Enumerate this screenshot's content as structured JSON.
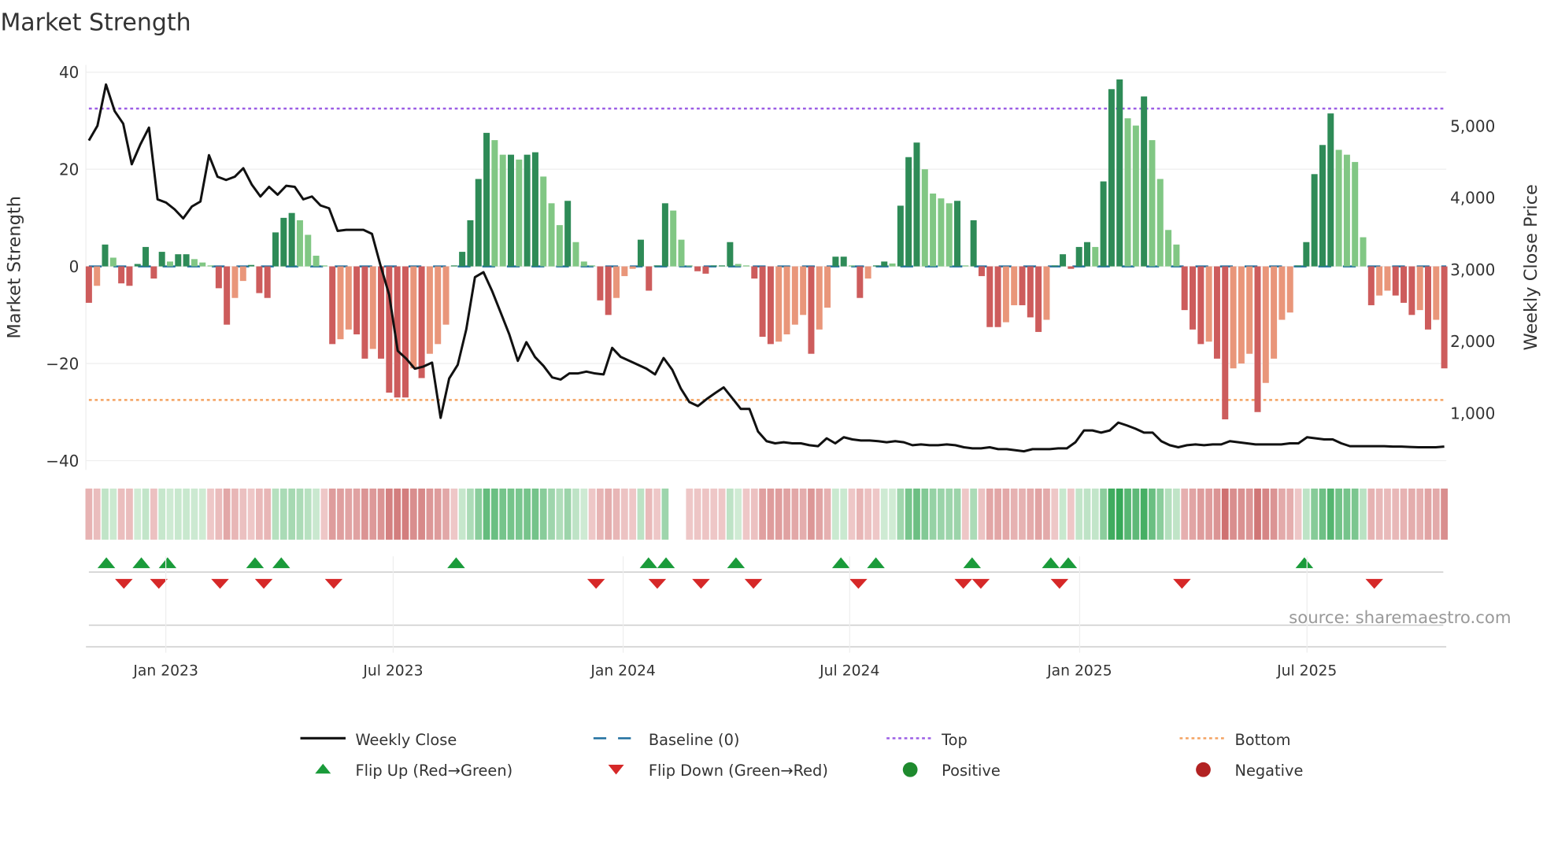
{
  "title": "Market Strength",
  "source": "source: sharemaestro.com",
  "colors": {
    "up_strong": "#2e8b57",
    "up_weak": "#81c784",
    "down_strong": "#cd5c5c",
    "down_weak": "#e9967a",
    "baseline": "#1f6f9f",
    "top": "#9b5de5",
    "bottom": "#f4a261",
    "flip_up": "#1a9b3a",
    "flip_down": "#d62828",
    "line": "#111111",
    "positive": "#1e8a2e",
    "negative": "#b22222"
  },
  "chart_data": {
    "type": "bar",
    "title": "Market Strength",
    "ylabel": "Market Strength",
    "y2label": "Weekly Close Price",
    "ylim": [
      -42,
      42
    ],
    "y2lim": [
      330,
      5740
    ],
    "yticks": [
      "40",
      "20",
      "0",
      "−20",
      "−40"
    ],
    "ytick_values": [
      40,
      20,
      0,
      -20,
      -40
    ],
    "y2ticks": [
      "5,000",
      "4,000",
      "3,000",
      "2,000",
      "1,000"
    ],
    "y2tick_values": [
      5000,
      4000,
      3000,
      2000,
      1000
    ],
    "xticks": [
      "Jan 2023",
      "Jul 2023",
      "Jan 2024",
      "Jul 2024",
      "Jan 2025",
      "Jul 2025"
    ],
    "xtick_weeks": [
      8.8,
      34.8,
      61.1,
      87.0,
      113.3,
      139.3
    ],
    "weeks": 156,
    "top_level": 32.5,
    "bottom_level": -27.5,
    "baseline": 0,
    "strength": [
      -7.5,
      -4,
      4.5,
      1.8,
      -3.5,
      -4,
      0.5,
      4,
      -2.5,
      3,
      1,
      2.5,
      2.5,
      1.5,
      0.8,
      0.2,
      -4.5,
      -12,
      -6.5,
      -3,
      0.3,
      -5.5,
      -6.5,
      7,
      10,
      11,
      9.5,
      6.5,
      2.2,
      0.2,
      -16,
      -15,
      -13,
      -14,
      -19,
      -17,
      -19,
      -26,
      -27,
      -27,
      -21,
      -23,
      -18,
      -16,
      -12,
      0.2,
      3,
      9.5,
      18,
      27.5,
      26,
      23,
      23,
      22,
      23,
      23.5,
      18.5,
      13,
      8.5,
      13.5,
      5,
      1,
      0.2,
      -7,
      -10,
      -6.5,
      -2,
      -0.5,
      5.5,
      -5,
      0.2,
      13,
      11.5,
      5.5,
      0.2,
      -1,
      -1.5,
      0.2,
      0.2,
      5,
      0.5,
      0.2,
      -2.5,
      -14.5,
      -16,
      -15.5,
      -14,
      -12,
      -10,
      -18,
      -13,
      -8.5,
      2,
      2,
      0.2,
      -6.5,
      -2.5,
      0.2,
      1,
      0.6,
      12.5,
      22.5,
      25.5,
      20,
      15,
      14,
      13,
      13.5,
      0.2,
      9.5,
      -2,
      -12.5,
      -12.5,
      -11.5,
      -8,
      -8,
      -10.5,
      -13.5,
      -11,
      0.2,
      2.5,
      -0.5,
      4,
      5,
      4,
      17.5,
      36.5,
      38.5,
      30.5,
      29,
      35,
      26,
      18,
      7.5,
      4.5,
      -9,
      -13,
      -16,
      -15.5,
      -19,
      -31.5,
      -21,
      -20,
      -18,
      -30,
      -24,
      -19,
      -11,
      -9.5,
      0.2,
      5,
      19,
      25,
      31.5,
      24,
      23,
      21.5,
      6,
      -8,
      -6,
      -5,
      -6,
      -7.5,
      -10,
      -9,
      -13,
      -11,
      -21
    ],
    "weekly_close": [
      4795,
      5000,
      5575,
      5205,
      5030,
      4465,
      4740,
      4975,
      3975,
      3930,
      3835,
      3710,
      3875,
      3945,
      4590,
      4290,
      4245,
      4290,
      4410,
      4180,
      4015,
      4150,
      4040,
      4165,
      4150,
      3975,
      4015,
      3890,
      3850,
      3535,
      3550,
      3550,
      3550,
      3495,
      3055,
      2645,
      1865,
      1755,
      1615,
      1645,
      1700,
      930,
      1480,
      1670,
      2165,
      2890,
      2960,
      2700,
      2400,
      2095,
      1725,
      1985,
      1780,
      1655,
      1495,
      1465,
      1550,
      1550,
      1575,
      1550,
      1535,
      1905,
      1780,
      1725,
      1670,
      1615,
      1535,
      1765,
      1600,
      1340,
      1150,
      1095,
      1190,
      1275,
      1355,
      1205,
      1055,
      1055,
      740,
      605,
      575,
      590,
      575,
      575,
      550,
      535,
      645,
      575,
      660,
      630,
      615,
      615,
      605,
      590,
      605,
      590,
      550,
      560,
      550,
      550,
      560,
      550,
      520,
      505,
      505,
      520,
      495,
      495,
      480,
      465,
      495,
      495,
      495,
      505,
      505,
      590,
      755,
      755,
      725,
      755,
      865,
      825,
      780,
      725,
      725,
      605,
      550,
      520,
      550,
      560,
      550,
      560,
      560,
      605,
      590,
      575,
      560,
      560,
      560,
      560,
      575,
      575,
      660,
      645,
      630,
      630,
      575,
      535,
      535,
      535,
      535,
      535,
      530,
      530,
      525,
      520,
      520,
      520,
      530
    ],
    "flip_up_weeks": [
      2,
      6,
      9,
      19,
      22,
      42,
      64,
      66,
      74,
      86,
      90,
      101,
      110,
      112,
      139
    ],
    "flip_down_weeks": [
      4,
      8,
      15,
      20,
      28,
      58,
      65,
      70,
      76,
      88,
      100,
      102,
      111,
      125,
      147
    ],
    "legend": {
      "placement": "bottom",
      "items": [
        "Weekly Close",
        "Baseline (0)",
        "Top",
        "Bottom",
        "Flip Up (Red→Green)",
        "Flip Down (Green→Red)",
        "Positive",
        "Negative"
      ]
    }
  }
}
